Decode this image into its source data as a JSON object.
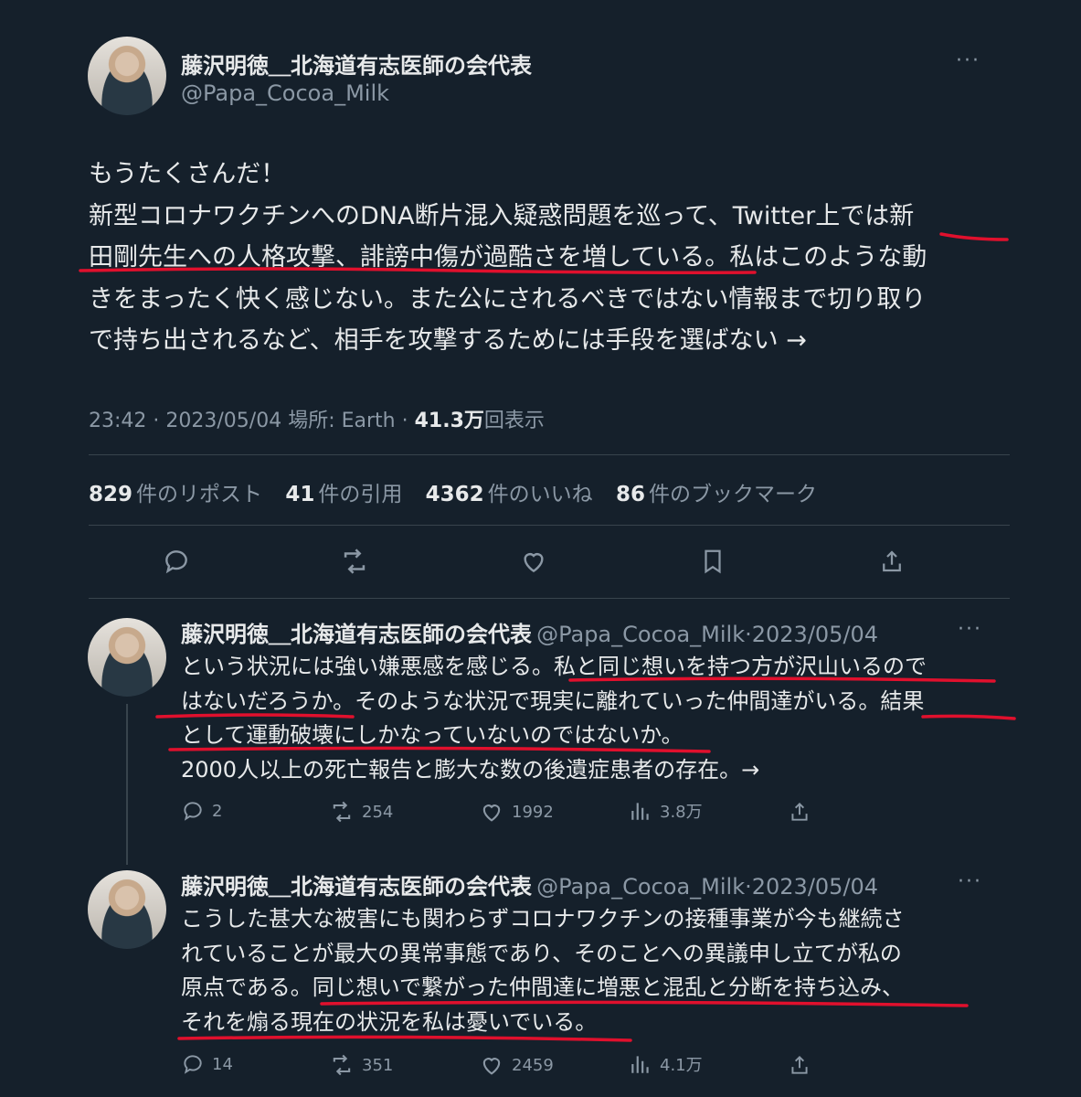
{
  "main": {
    "author_name": "藤沢明徳＿北海道有志医師の会代表",
    "author_handle": "@Papa_Cocoa_Milk",
    "more_label": "···",
    "text_lines": [
      "もうたくさんだ！",
      "新型コロナワクチンへのDNA断片混入疑惑問題を巡って、Twitter上では新",
      "田剛先生への人格攻撃、誹謗中傷が過酷さを増している。私はこのような動",
      "きをまったく快く感じない。また公にされるべきではない情報まで切り取り",
      "で持ち出されるなど、相手を攻撃するためには手段を選ばない →"
    ],
    "time": "23:42",
    "date": "2023/05/04",
    "location_label": "場所: Earth",
    "views_value": "41.3万",
    "views_label": "回表示",
    "stats": [
      {
        "value": "829",
        "label": "件のリポスト"
      },
      {
        "value": "41",
        "label": "件の引用"
      },
      {
        "value": "4362",
        "label": "件のいいね"
      },
      {
        "value": "86",
        "label": "件のブックマーク"
      }
    ]
  },
  "replies": [
    {
      "author_name": "藤沢明徳＿北海道有志医師の会代表",
      "author_handle": "@Papa_Cocoa_Milk",
      "date": "·2023/05/04",
      "text_lines": [
        "という状況には強い嫌悪感を感じる。私と同じ想いを持つ方が沢山いるので",
        "はないだろうか。そのような状況で現実に離れていった仲間達がいる。結果",
        "として運動破壊にしかなっていないのではないか。",
        "2000人以上の死亡報告と膨大な数の後遺症患者の存在。→"
      ],
      "replies": "2",
      "reposts": "254",
      "likes": "1992",
      "views": "3.8万"
    },
    {
      "author_name": "藤沢明徳＿北海道有志医師の会代表",
      "author_handle": "@Papa_Cocoa_Milk",
      "date": "·2023/05/04",
      "text_lines": [
        "こうした甚大な被害にも関わらずコロナワクチンの接種事業が今も継続さ",
        "れていることが最大の異常事態であり、そのことへの異議申し立てが私の",
        "原点である。同じ想いで繋がった仲間達に増悪と混乱と分断を持ち込み、",
        "それを煽る現在の状況を私は憂いでいる。"
      ],
      "replies": "14",
      "reposts": "351",
      "likes": "2459",
      "views": "4.1万"
    }
  ],
  "colors": {
    "background": "#15202b",
    "text": "#e7e9ea",
    "secondary": "#8b98a5",
    "divider": "#38444d",
    "underline": "#e0102d"
  }
}
